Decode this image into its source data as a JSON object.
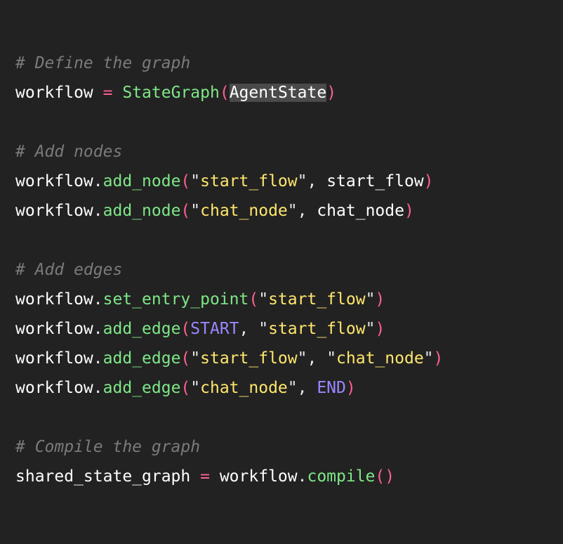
{
  "editor": {
    "colors": {
      "background": "#222222",
      "comment": "#7b7b7b",
      "function": "#7ee787",
      "string": "#ffe66d",
      "paren": "#ff5f8f",
      "constant": "#9a88ff",
      "selection": "#4a4a4a"
    },
    "lines": {
      "l1": {
        "comment": "# Define the graph"
      },
      "l2": {
        "var": "workflow",
        "op": "=",
        "func": "StateGraph",
        "arg": "AgentState"
      },
      "l4": {
        "comment": "# Add nodes"
      },
      "l5": {
        "obj": "workflow",
        "method": "add_node",
        "s1": "start_flow",
        "arg2": "start_flow"
      },
      "l6": {
        "obj": "workflow",
        "method": "add_node",
        "s1": "chat_node",
        "arg2": "chat_node"
      },
      "l8": {
        "comment": "# Add edges"
      },
      "l9": {
        "obj": "workflow",
        "method": "set_entry_point",
        "s1": "start_flow"
      },
      "l10": {
        "obj": "workflow",
        "method": "add_edge",
        "c1": "START",
        "s2": "start_flow"
      },
      "l11": {
        "obj": "workflow",
        "method": "add_edge",
        "s1": "start_flow",
        "s2": "chat_node"
      },
      "l12": {
        "obj": "workflow",
        "method": "add_edge",
        "s1": "chat_node",
        "c2": "END"
      },
      "l14": {
        "comment": "# Compile the graph"
      },
      "l15": {
        "var": "shared_state_graph",
        "op": "=",
        "obj": "workflow",
        "method": "compile"
      }
    }
  }
}
